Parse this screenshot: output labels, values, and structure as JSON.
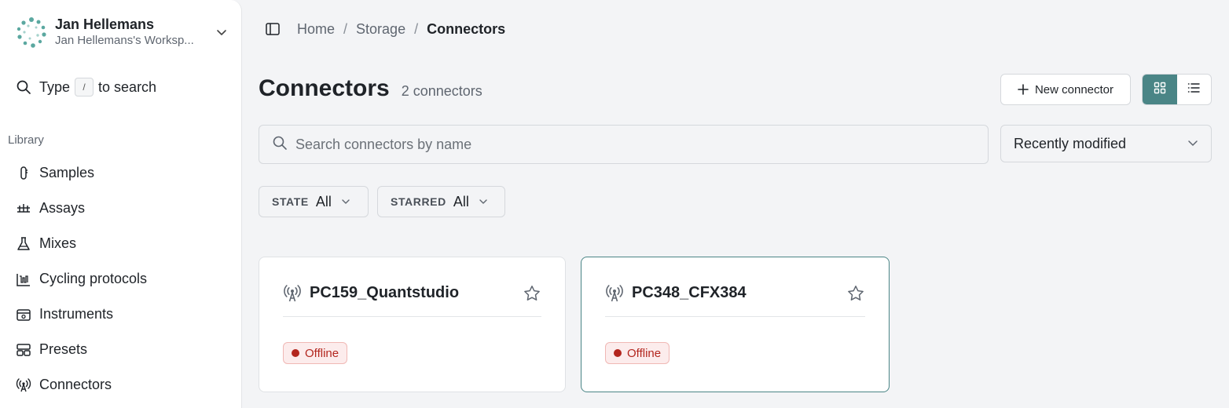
{
  "workspace": {
    "name": "Jan Hellemans",
    "subtitle": "Jan Hellemans's Worksp..."
  },
  "sidebar_search": {
    "prefix": "Type",
    "key": "/",
    "suffix": "to search"
  },
  "sidebar": {
    "section_label": "Library",
    "items": [
      {
        "label": "Samples",
        "icon": "sample-tube-icon"
      },
      {
        "label": "Assays",
        "icon": "assay-icon"
      },
      {
        "label": "Mixes",
        "icon": "flask-icon"
      },
      {
        "label": "Cycling protocols",
        "icon": "cycling-chart-icon"
      },
      {
        "label": "Instruments",
        "icon": "instrument-icon"
      },
      {
        "label": "Presets",
        "icon": "presets-icon"
      },
      {
        "label": "Connectors",
        "icon": "antenna-icon"
      }
    ]
  },
  "breadcrumb": [
    "Home",
    "Storage",
    "Connectors"
  ],
  "page": {
    "title": "Connectors",
    "count": "2 connectors"
  },
  "toolbar": {
    "new_label": "New connector"
  },
  "search": {
    "placeholder": "Search connectors by name"
  },
  "sort": {
    "value": "Recently modified"
  },
  "filters": [
    {
      "label": "STATE",
      "value": "All"
    },
    {
      "label": "STARRED",
      "value": "All"
    }
  ],
  "connectors": [
    {
      "name": "PC159_Quantstudio",
      "status": "Offline"
    },
    {
      "name": "PC348_CFX384",
      "status": "Offline"
    }
  ],
  "colors": {
    "accent": "#4a8586",
    "offline": "#b3261e",
    "offline_bg": "#fcecec"
  }
}
